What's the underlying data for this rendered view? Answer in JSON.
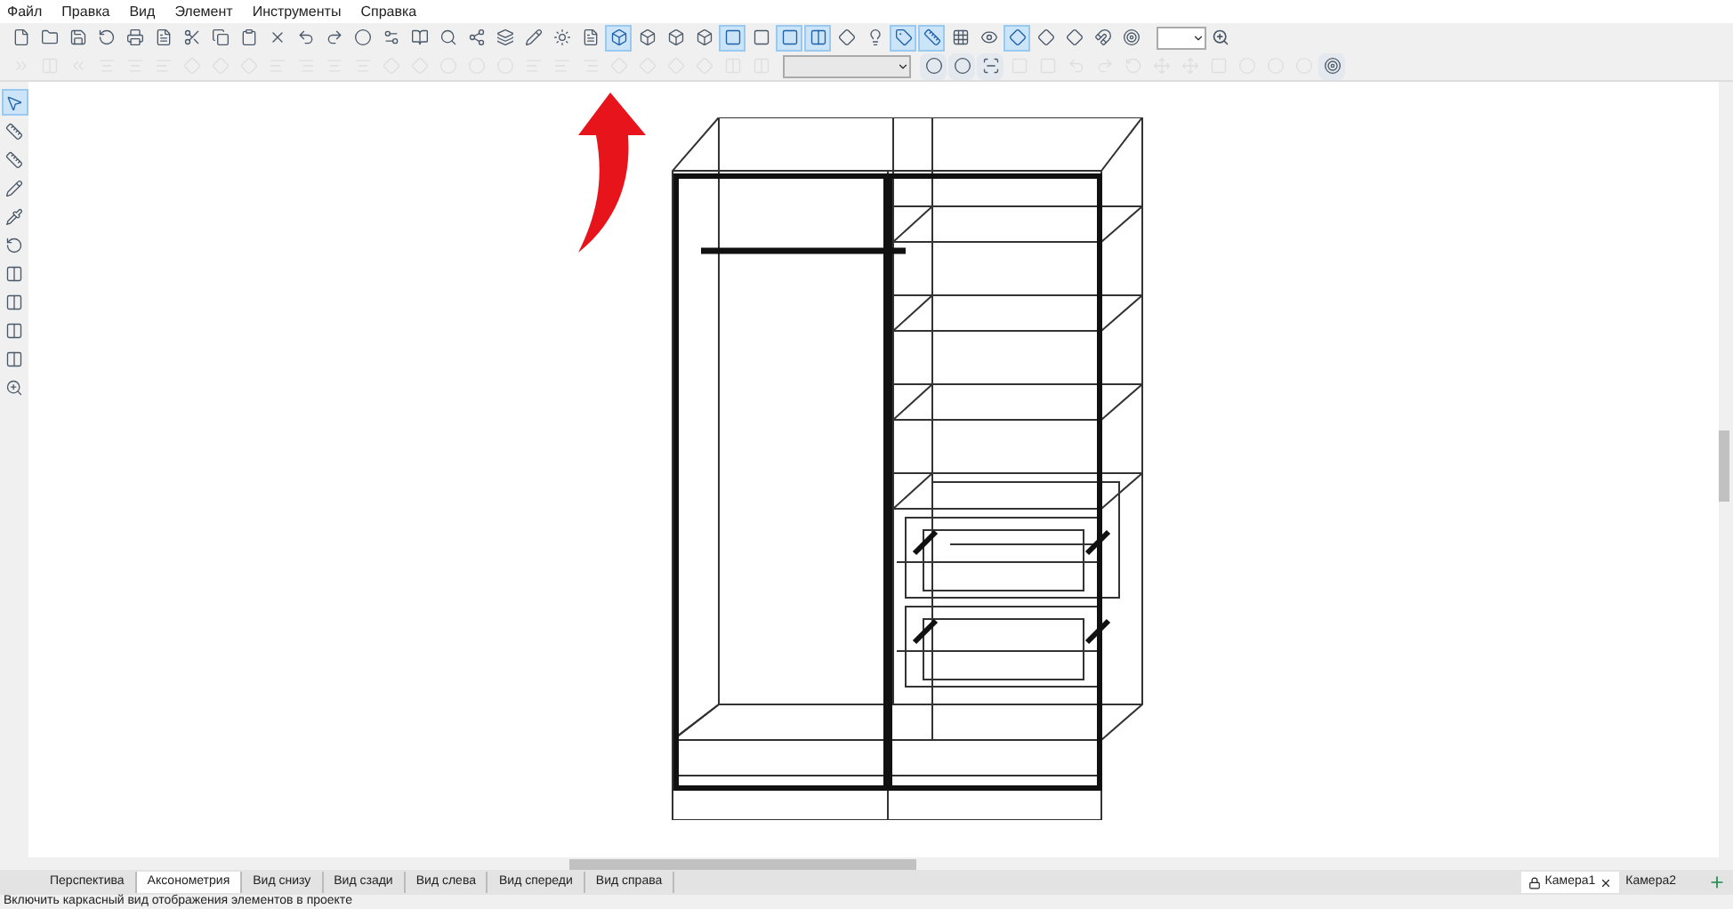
{
  "menu": [
    "Файл",
    "Правка",
    "Вид",
    "Элемент",
    "Инструменты",
    "Справка"
  ],
  "top_toolbar": {
    "buttons": [
      {
        "selected": false
      },
      {
        "selected": false
      },
      {
        "selected": false
      },
      {
        "selected": false
      },
      {
        "selected": false
      },
      {
        "selected": false
      },
      {
        "selected": false
      },
      {
        "selected": false
      },
      {
        "selected": false
      },
      {
        "selected": false
      },
      {
        "selected": false
      },
      {
        "selected": false
      },
      {
        "selected": false
      },
      {
        "selected": false
      },
      {
        "selected": false
      },
      {
        "selected": false
      },
      {
        "selected": false
      },
      {
        "selected": false
      },
      {
        "selected": false
      },
      {
        "selected": false
      },
      {
        "selected": false
      },
      {
        "selected": true
      },
      {
        "selected": false
      },
      {
        "selected": false
      },
      {
        "selected": false
      },
      {
        "selected": true
      },
      {
        "selected": false
      },
      {
        "selected": true
      },
      {
        "selected": true
      },
      {
        "selected": false
      },
      {
        "selected": false
      },
      {
        "selected": true
      },
      {
        "selected": true
      },
      {
        "selected": false
      },
      {
        "selected": false
      },
      {
        "selected": true
      },
      {
        "selected": false
      },
      {
        "selected": false
      },
      {
        "selected": false
      },
      {
        "selected": false
      }
    ]
  },
  "bottom_toolbar": {
    "buttons": [
      {
        "disabled": true
      },
      {
        "disabled": true
      },
      {
        "disabled": true
      },
      {
        "disabled": true
      },
      {
        "disabled": true
      },
      {
        "disabled": true
      },
      {
        "disabled": true
      },
      {
        "disabled": true
      },
      {
        "disabled": true
      },
      {
        "disabled": true
      },
      {
        "disabled": true
      },
      {
        "disabled": true
      },
      {
        "disabled": true
      },
      {
        "disabled": true
      },
      {
        "disabled": true
      },
      {
        "disabled": true
      },
      {
        "disabled": true
      },
      {
        "disabled": true
      },
      {
        "disabled": true
      },
      {
        "disabled": true
      },
      {
        "disabled": true
      },
      {
        "disabled": true
      },
      {
        "disabled": true
      },
      {
        "disabled": true
      },
      {
        "disabled": true
      },
      {
        "disabled": true
      },
      {
        "disabled": true
      },
      {
        "disabled": false
      },
      {
        "disabled": false
      },
      {
        "disabled": false
      },
      {
        "disabled": true
      },
      {
        "disabled": true
      },
      {
        "disabled": true
      },
      {
        "disabled": true
      },
      {
        "disabled": true
      },
      {
        "disabled": true
      },
      {
        "disabled": true
      },
      {
        "disabled": true
      },
      {
        "disabled": true
      },
      {
        "disabled": true
      },
      {
        "disabled": true
      },
      {
        "disabled": false
      }
    ]
  },
  "left_toolbar": {
    "buttons": [
      {
        "selected": true
      },
      {
        "selected": false
      },
      {
        "selected": false
      },
      {
        "selected": false
      },
      {
        "selected": false
      },
      {
        "selected": false
      },
      {
        "selected": false
      },
      {
        "selected": false
      },
      {
        "selected": false
      },
      {
        "selected": false
      },
      {
        "selected": false
      }
    ]
  },
  "view_tabs": [
    {
      "label": "Перспектива",
      "selected": false
    },
    {
      "label": "Аксонометрия",
      "selected": true
    },
    {
      "label": "Вид снизу",
      "selected": false
    },
    {
      "label": "Вид сзади",
      "selected": false
    },
    {
      "label": "Вид слева",
      "selected": false
    },
    {
      "label": "Вид спереди",
      "selected": false
    },
    {
      "label": "Вид справа",
      "selected": false
    }
  ],
  "camera_tabs": [
    {
      "label": "Камера1",
      "selected": true
    },
    {
      "label": "Камера2",
      "selected": false
    }
  ],
  "status_bar": "Включить каркасный вид отображения элементов в проекте"
}
